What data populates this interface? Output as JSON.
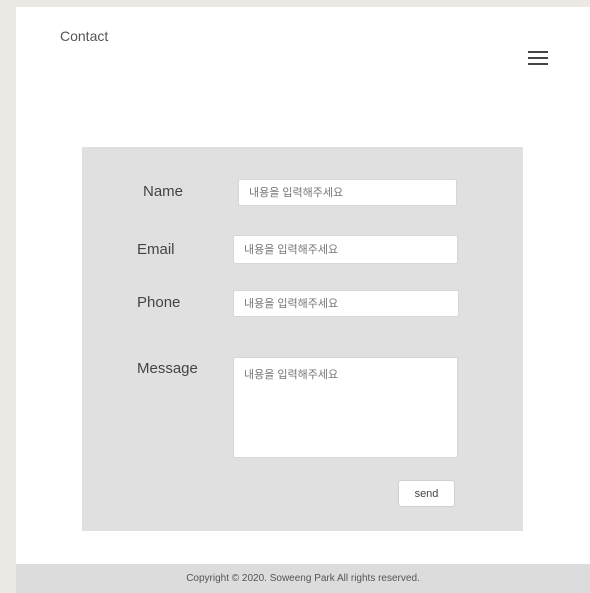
{
  "header": {
    "brand": "Contact",
    "menu_icon": "hamburger-menu-icon"
  },
  "form": {
    "name": {
      "label": "Name",
      "placeholder": "내용을 입력해주세요"
    },
    "email": {
      "label": "Email",
      "placeholder": "내용을 입력해주세요"
    },
    "phone": {
      "label": "Phone",
      "placeholder": "내용을 입력해주세요"
    },
    "message": {
      "label": "Message",
      "placeholder": "내용을 입력해주세요"
    },
    "send_label": "send"
  },
  "footer": {
    "copyright": "Copyright © 2020. Soweeng Park All rights reserved."
  },
  "colors": {
    "outer_background": "#ece8e4",
    "page_background": "#ffffff",
    "form_panel": "#e0e0e0",
    "footer_background": "#dcdcdc"
  }
}
